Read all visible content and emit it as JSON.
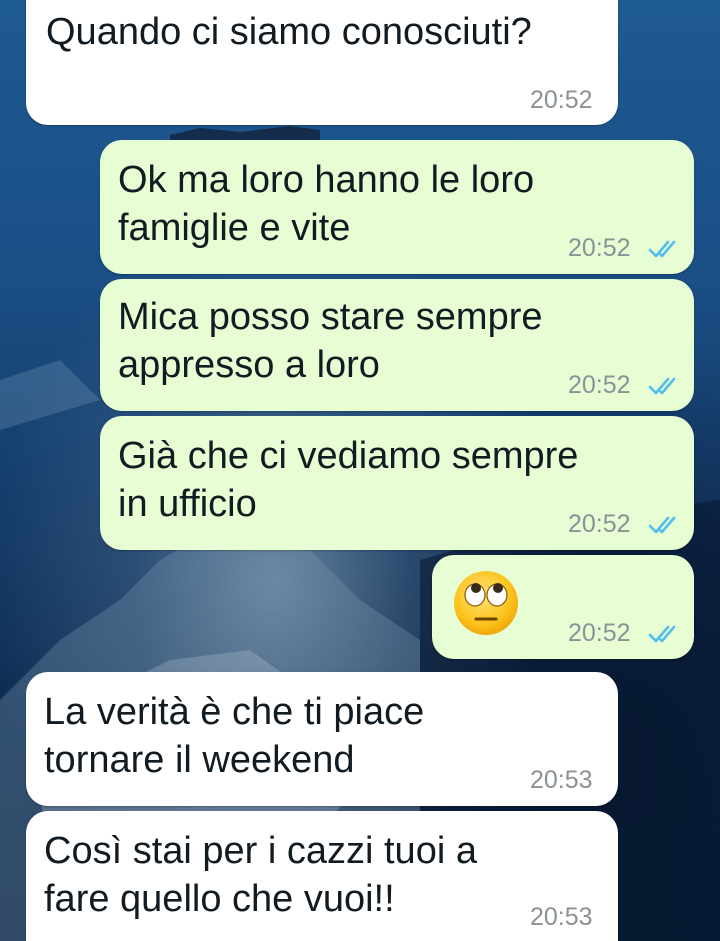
{
  "chat": {
    "messages": [
      {
        "id": "m1",
        "direction": "incoming",
        "text": "Quando ci siamo conosciuti?",
        "time": "20:52"
      },
      {
        "id": "m2",
        "direction": "outgoing",
        "text": "Ok ma loro hanno le loro\nfamiglie e vite",
        "time": "20:52",
        "status": "read"
      },
      {
        "id": "m3",
        "direction": "outgoing",
        "text": "Mica posso stare sempre\nappresso a loro",
        "time": "20:52",
        "status": "read"
      },
      {
        "id": "m4",
        "direction": "outgoing",
        "text": "Già che ci vediamo sempre\nin ufficio",
        "time": "20:52",
        "status": "read"
      },
      {
        "id": "m5",
        "direction": "outgoing",
        "emoji": "face-with-rolling-eyes",
        "time": "20:52",
        "status": "read"
      },
      {
        "id": "m6",
        "direction": "incoming",
        "text": "La verità è che ti piace\ntornare il weekend",
        "time": "20:53"
      },
      {
        "id": "m7",
        "direction": "incoming",
        "text": "Così stai per i cazzi tuoi a\nfare quello che vuoi!!",
        "time": "20:53"
      }
    ]
  },
  "colors": {
    "incoming_bubble": "#ffffff",
    "outgoing_bubble": "#e7fdd3",
    "read_ticks": "#53bdeb",
    "timestamp": "#8a9296"
  },
  "icons": {
    "read_receipt": "double-check-icon",
    "emoji": "face-with-rolling-eyes-emoji"
  }
}
